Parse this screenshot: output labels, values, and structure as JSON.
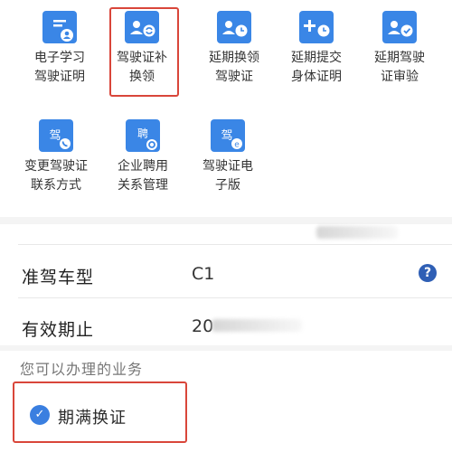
{
  "services_row1": [
    {
      "icon": "id-card-person-icon",
      "label": "电子学习\n驾驶证明"
    },
    {
      "icon": "id-card-replace-icon",
      "label": "驾驶证补\n换领"
    },
    {
      "icon": "id-card-clock-icon",
      "label": "延期换领\n驾驶证"
    },
    {
      "icon": "id-card-plus-clock-icon",
      "label": "延期提交\n身体证明"
    },
    {
      "icon": "id-card-check-icon",
      "label": "延期驾驶\n证审验"
    }
  ],
  "services_row2": [
    {
      "icon": "license-phone-icon",
      "label": "变更驾驶证\n联系方式",
      "glyph": "驾"
    },
    {
      "icon": "document-gear-icon",
      "label": "企业聘用\n关系管理",
      "glyph": "聘"
    },
    {
      "icon": "license-electronic-icon",
      "label": "驾驶证电\n子版",
      "glyph": "驾"
    }
  ],
  "license_info": {
    "class_label": "准驾车型",
    "class_value": "C1",
    "validity_label": "有效期止",
    "validity_value": "20",
    "help_glyph": "?"
  },
  "business": {
    "heading": "您可以办理的业务",
    "items": [
      {
        "label": "期满换证",
        "checked": true
      }
    ]
  },
  "colors": {
    "icon_blue": "#3a86e6",
    "highlight_red": "#d9463a"
  }
}
